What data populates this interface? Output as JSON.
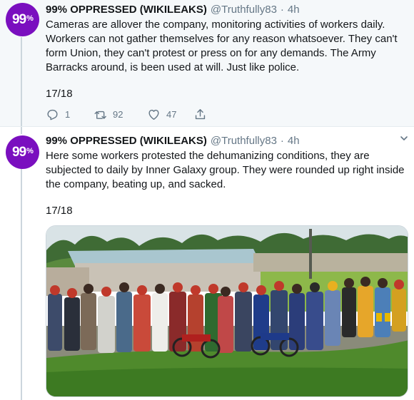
{
  "tweets": [
    {
      "display_name": "99% OPPRESSED (WIKILEAKS)",
      "handle": "@Truthfully83",
      "separator": "·",
      "time": "4h",
      "avatar_text": "99",
      "avatar_suffix": "%",
      "avatar_color": "#7a0fbf",
      "text": "Cameras are allover the company, monitoring activities of workers daily. Workers can not gather themselves for any reason whatsoever. They can't form Union, they can't protest or press on for any demands. The Army Barracks around, is been used at will. Just like police.",
      "thread_counter": "17/18",
      "replies": "1",
      "retweets": "92",
      "likes": "47"
    },
    {
      "display_name": "99% OPPRESSED (WIKILEAKS)",
      "handle": "@Truthfully83",
      "separator": "·",
      "time": "4h",
      "avatar_text": "99",
      "avatar_suffix": "%",
      "avatar_color": "#7a0fbf",
      "text": "Here some workers protested the dehumanizing conditions, they are subjected to daily by Inner Galaxy group. They were rounded up right inside the company, beating up, and sacked.",
      "thread_counter": "17/18",
      "media_description_icon": "photo-crowd-of-workers"
    }
  ],
  "colors": {
    "brand_purple": "#7a0fbf",
    "secondary_text": "#657786",
    "highlight_bg": "#f5f8fa",
    "thread_line": "#ccd6dd"
  }
}
